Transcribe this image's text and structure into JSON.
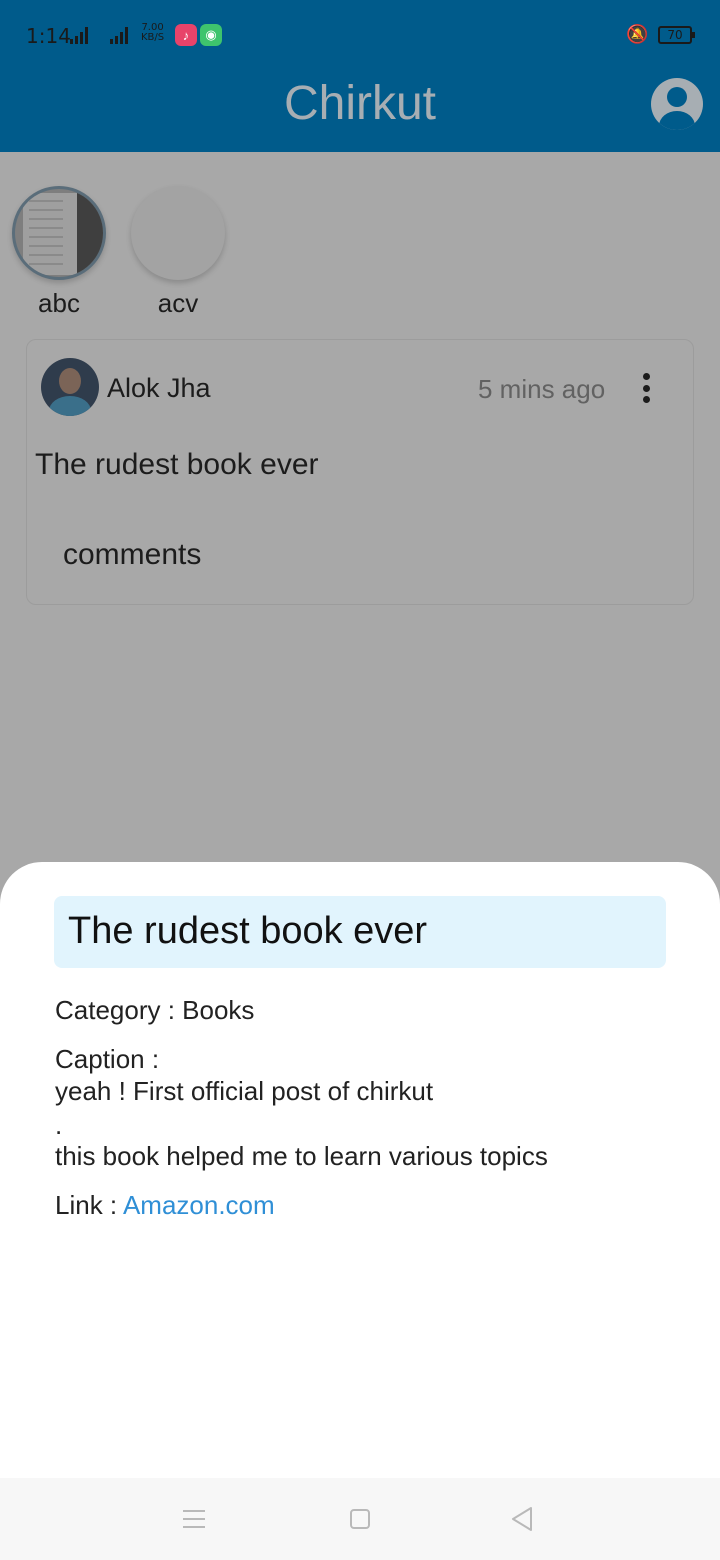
{
  "status_bar": {
    "time": "1:14",
    "network_speed_value": "7.00",
    "network_speed_unit": "KB/S",
    "battery": "70",
    "icons": [
      "signal-icon",
      "signal-hd-icon",
      "music-app-icon",
      "chat-app-icon",
      "vibrate-mute-icon",
      "battery-icon"
    ]
  },
  "app_bar": {
    "title": "Chirkut",
    "account_icon": "account-circle-icon"
  },
  "stories": [
    {
      "label": "abc"
    },
    {
      "label": "acv"
    }
  ],
  "post": {
    "author": "Alok Jha",
    "time": "5 mins ago",
    "title": "The rudest book ever",
    "comments_label": "comments"
  },
  "sheet": {
    "title": "The rudest book ever",
    "category_line": "Category : Books",
    "caption_label": "Caption :",
    "caption_lines": [
      "yeah ! First official post of chirkut",
      ".",
      "this book helped me to learn various topics"
    ],
    "link_label": "Link :",
    "link_text": "Amazon.com",
    "colors": {
      "title_bg": "#e1f4fd",
      "link": "#2f8fd6"
    }
  },
  "colors": {
    "app_bar": "#005b8b",
    "app_title": "#a7aeb3"
  },
  "nav_bar": {
    "icons": [
      "menu-icon",
      "home-icon",
      "back-icon"
    ]
  }
}
